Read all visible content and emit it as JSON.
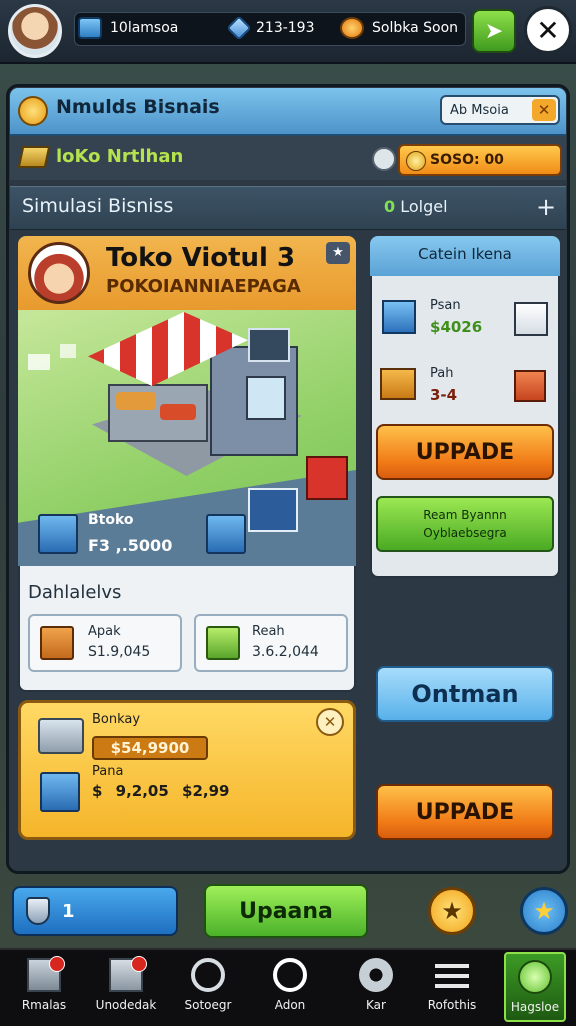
{
  "hud": {
    "res1_value": "10lamsoa",
    "res2_value": "213-193",
    "res3_value": "Solbka Soon",
    "share_icon": "leaf-arrow-icon",
    "close_label": "✕"
  },
  "panel": {
    "title": "Nmulds Bisnais",
    "top_button": "Ab Msoia",
    "top_button_x": "✕",
    "subtitle": "loKo Nrtlhan",
    "coin_pill": "SOSO: 00",
    "section_title": "Simulasi Bisniss",
    "status_prefix": "0",
    "status_text": "Lolgel",
    "plus": "+"
  },
  "shop": {
    "name": "Toko Viotul 3",
    "subname": "POKOIANNIAEPAGA",
    "stock_label": "Btoko",
    "stock_value": "F3 ,.5000",
    "stats_title": "Dahlalelvs",
    "stat1_label": "Apak",
    "stat1_value": "S1.9,045",
    "stat2_label": "Reah",
    "stat2_value": "3.6.2,044"
  },
  "right": {
    "title": "Catein Ikena",
    "item1_label": "Psan",
    "item1_value": "4026",
    "item2_label": "Pah",
    "item2_value": "3-4",
    "upgrade1": "UPPADE",
    "green_line1": "Ream Byannn",
    "green_line2": "Oyblaebsegra",
    "sky_button": "Ontman",
    "upgrade2": "UPPADE"
  },
  "yellow": {
    "label1": "Bonkay",
    "money": "$54,9900",
    "label2": "Pana",
    "val1": "$ 9,2,05",
    "val2": "$2,99"
  },
  "controls": {
    "level": "1",
    "update": "Upaana",
    "star": "★"
  },
  "nav": [
    {
      "label": "Rmalas",
      "icon": "building-icon"
    },
    {
      "label": "Unodedak",
      "icon": "warehouse-icon"
    },
    {
      "label": "Sotoegr",
      "icon": "magnifier-icon"
    },
    {
      "label": "Adon",
      "icon": "search-icon"
    },
    {
      "label": "Kar",
      "icon": "gear-icon"
    },
    {
      "label": "Rofothis",
      "icon": "sliders-icon"
    },
    {
      "label": "Hagsloe",
      "icon": "download-icon"
    }
  ],
  "colors": {
    "accent_orange": "#f07a17",
    "accent_green": "#4bb22a",
    "accent_blue": "#2a7ec9"
  }
}
